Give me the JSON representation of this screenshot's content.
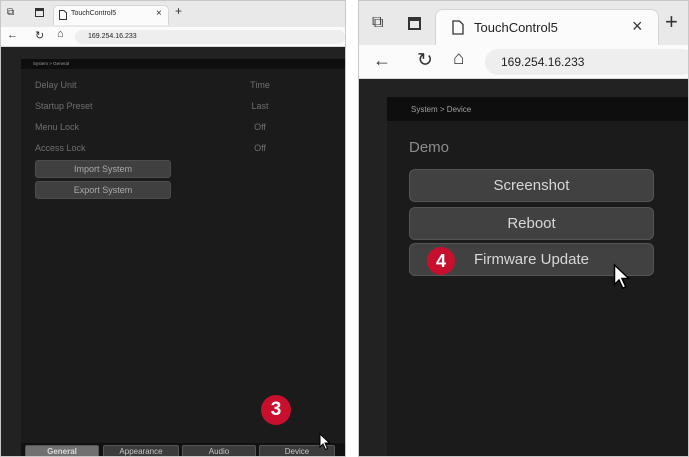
{
  "left": {
    "tab_title": "TouchControl5",
    "url": "169.254.16.233",
    "breadcrumb": "System > General",
    "settings": [
      {
        "label": "Delay Unit",
        "value": "Time"
      },
      {
        "label": "Startup Preset",
        "value": "Last"
      },
      {
        "label": "Menu Lock",
        "value": "Off"
      },
      {
        "label": "Access Lock",
        "value": "Off"
      }
    ],
    "buttons": [
      "Import System",
      "Export System"
    ],
    "bottom_tabs": [
      "General",
      "Appearance",
      "Audio",
      "Device"
    ],
    "active_tab": "General",
    "step_badge": "3"
  },
  "right": {
    "tab_title": "TouchControl5",
    "url": "169.254.16.233",
    "breadcrumb": "System > Device",
    "section_title": "Demo",
    "buttons": [
      "Screenshot",
      "Reboot",
      "Firmware Update"
    ],
    "step_badge": "4"
  },
  "icons": {
    "tab_actions": "tab-actions-icon",
    "tab_list": "tab-list-icon",
    "page": "page-icon",
    "close": "close-icon",
    "new_tab": "plus-icon",
    "back": "back-arrow-icon",
    "refresh": "refresh-icon",
    "home": "home-icon",
    "pointer": "mouse-pointer-icon"
  },
  "colors": {
    "badge": "#c8102e",
    "app_background": "#1b1b1b",
    "button": "#414141"
  }
}
